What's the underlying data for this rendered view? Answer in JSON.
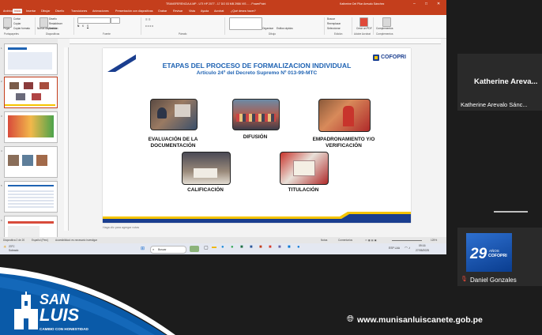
{
  "window": {
    "title": "TRANSFERENCIA A MP - UTI HP 2077 - 17 DO 03 MB 2986 VIS ... - PowerPoint",
    "user": "Katherine Del Pilar Arevalo Sánchez",
    "tabs": [
      "Archivo",
      "Inicio",
      "Insertar",
      "Dibujar",
      "Diseño",
      "Transiciones",
      "Animaciones",
      "Presentación con diapositivas",
      "Grabar",
      "Revisar",
      "Vista",
      "Ayuda",
      "Acrobat",
      "¿Qué desea hacer?"
    ],
    "active_tab": "Inicio"
  },
  "ribbon": {
    "groups": [
      "Portapapeles",
      "Diapositivas",
      "Fuente",
      "Párrafo",
      "Dibujo",
      "Edición",
      "Adobe Acrobat",
      "Complementos"
    ],
    "buttons": {
      "paste": "Pegar",
      "cut": "Cortar",
      "copy": "Copiar",
      "format": "Copiar formato",
      "new_slide": "Nueva diapositiva",
      "reuse": "Reutilizar diapositivas",
      "design": "Diseño",
      "reset": "Restablecer",
      "section": "Sección",
      "arrange": "Organizar",
      "quick_styles": "Estilos rápidos",
      "find": "Buscar",
      "replace": "Reemplazar",
      "select": "Seleccionar",
      "create_pdf": "Crear un PDF",
      "addins": "Complementos"
    }
  },
  "slide": {
    "title": "ETAPAS DEL PROCESO DE FORMALIZACION INDIVIDUAL",
    "subtitle": "Artículo 24º del Decreto Supremo Nº 013-99-MTC",
    "logo": "COFOPRI",
    "stages": [
      {
        "label_lines": [
          "EVALUACIÓN DE LA",
          "DOCUMENTACIÓN"
        ]
      },
      {
        "label_lines": [
          "DIFUSIÓN"
        ]
      },
      {
        "label_lines": [
          "EMPADRONAMIENTO Y/O",
          "VERIFICACIÓN"
        ]
      },
      {
        "label_lines": [
          "CALIFICACIÓN"
        ]
      },
      {
        "label_lines": [
          "TITULACIÓN"
        ]
      }
    ]
  },
  "thumbnails": [
    "1",
    "2",
    "3",
    "4",
    "5",
    "6",
    "7"
  ],
  "notes_placeholder": "Haga clic para agregar notas",
  "status": {
    "slide_count": "Diapositiva 2 de 20",
    "language": "Español (Perú)",
    "accessibility": "Accesibilidad: es necesario investigar",
    "notes": "Notas",
    "comments": "Comentarios",
    "zoom": "125%"
  },
  "taskbar": {
    "weather_temp": "23°C",
    "weather_desc": "Soleado",
    "search": "Buscar",
    "lang": "ESP LAA",
    "time": "09:16",
    "date": "27/05/2025"
  },
  "participants": [
    {
      "display": "Katherine Areva...",
      "full": "Katherine Arevalo Sánc..."
    },
    {
      "display": "Daniel Gonzales",
      "badge": "29",
      "badge_sub": "AÑOS",
      "badge_logo": "COFOPRI"
    }
  ],
  "banner": {
    "brand_top": "SAN",
    "brand_bottom": "LUIS",
    "tagline": "CAMBIO CON HONESTIDAD",
    "url": "www.munisanluiscanete.gob.pe"
  },
  "colors": {
    "ppt_accent": "#c43e1c",
    "slide_title": "#1f63b3",
    "banner_blue": "#0a5aa8",
    "cofopri_blue": "#1a3e8f",
    "cofopri_yellow": "#f5c400"
  }
}
